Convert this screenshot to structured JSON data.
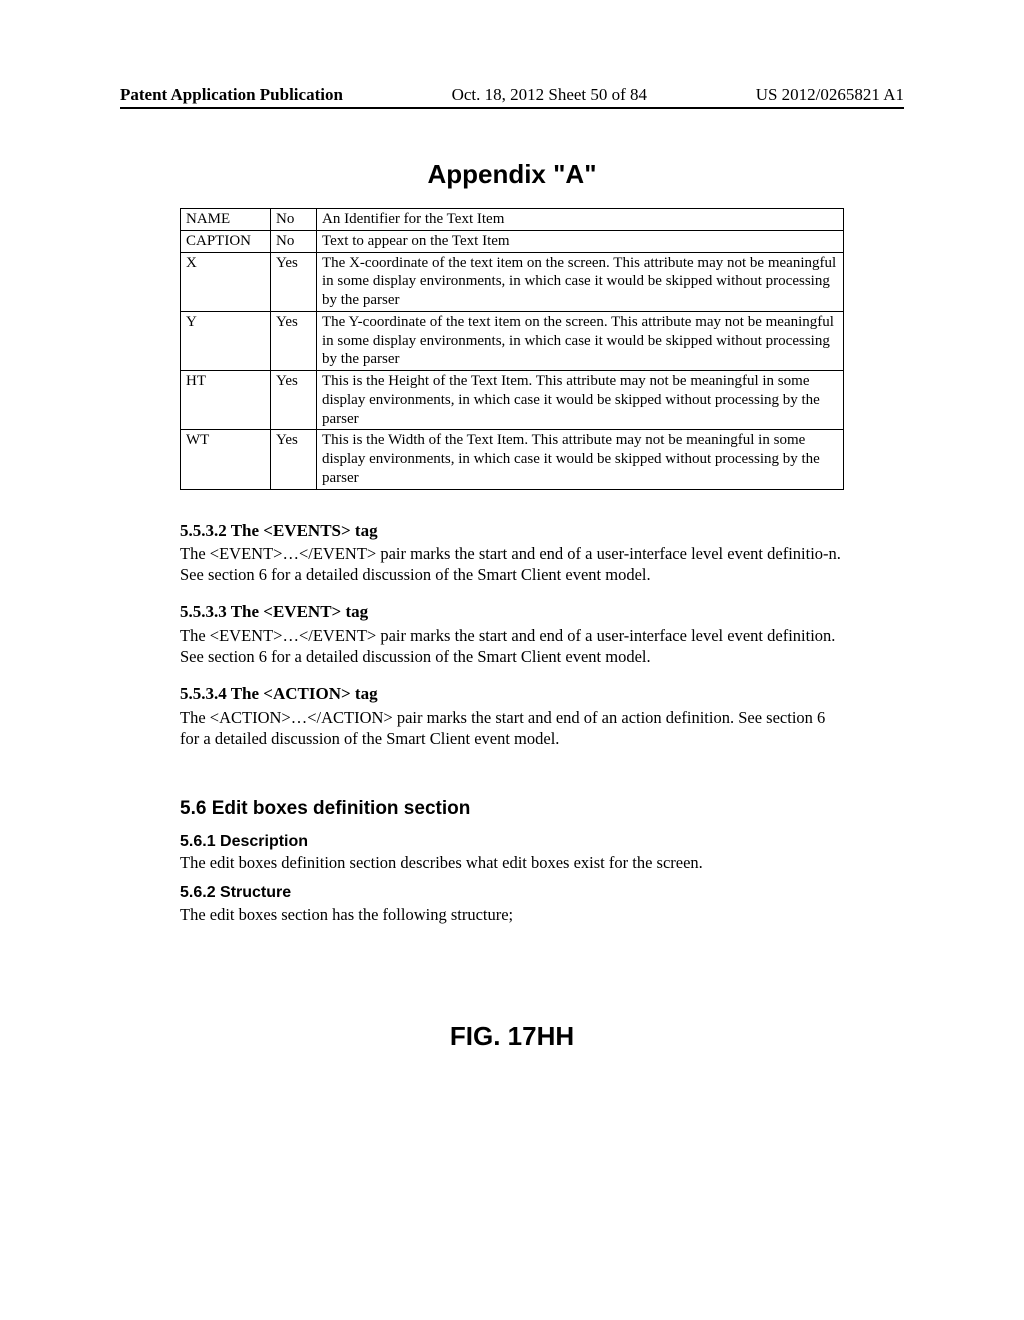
{
  "header": {
    "left": "Patent Application Publication",
    "mid": "Oct. 18, 2012  Sheet 50 of 84",
    "right": "US 2012/0265821 A1"
  },
  "title": "Appendix \"A\"",
  "table": {
    "rows": [
      {
        "name": "NAME",
        "opt": "No",
        "desc": "An Identifier for the Text Item"
      },
      {
        "name": "CAPTION",
        "opt": "No",
        "desc": "Text to appear on the Text Item"
      },
      {
        "name": "X",
        "opt": "Yes",
        "desc": "The X-coordinate of the text item on the screen. This attribute may not be meaningful in some display environments, in which case it would be skipped without processing by the parser"
      },
      {
        "name": "Y",
        "opt": "Yes",
        "desc": "The Y-coordinate of the text item on the screen. This attribute may not be meaningful in some display environments, in which case it would be skipped without processing by the parser"
      },
      {
        "name": "HT",
        "opt": "Yes",
        "desc": "This is the Height of the Text Item. This attribute may not be meaningful in some display environments, in which case it would be skipped without processing by the parser"
      },
      {
        "name": "WT",
        "opt": "Yes",
        "desc": "This is the Width of the Text Item. This attribute may not be meaningful in some display environments, in which case it would be skipped without processing by the parser"
      }
    ]
  },
  "sections": {
    "s1": {
      "heading": "5.5.3.2  The <EVENTS> tag",
      "body": "The <EVENT>…</EVENT> pair marks the start and end of a user-interface level event definitio-n. See section 6 for a detailed discussion of the Smart Client event model."
    },
    "s2": {
      "heading": "5.5.3.3  The <EVENT> tag",
      "body": "The <EVENT>…</EVENT> pair marks the start and end of a user-interface level event definition. See section 6 for a detailed discussion of the Smart Client event model."
    },
    "s3": {
      "heading": "5.5.3.4  The <ACTION> tag",
      "body": "The <ACTION>…</ACTION> pair marks the start and end of an action definition. See section 6 for a detailed discussion of the Smart Client event model."
    },
    "s4": {
      "heading": "5.6  Edit boxes definition section"
    },
    "s5": {
      "heading": "5.6.1  Description",
      "body": "The edit boxes definition section describes what edit boxes exist for the screen."
    },
    "s6": {
      "heading": "5.6.2  Structure",
      "body": "The edit boxes section has the following structure;"
    }
  },
  "figure": "FIG. 17HH"
}
